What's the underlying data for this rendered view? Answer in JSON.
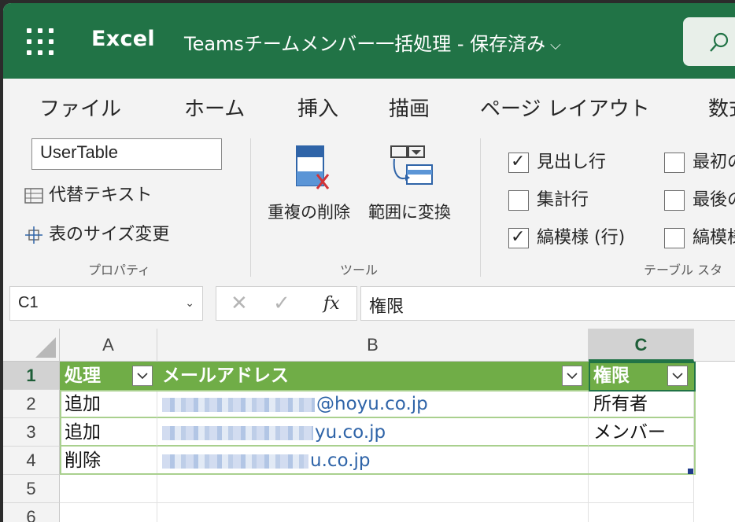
{
  "titlebar": {
    "app_name": "Excel",
    "doc_title": "Teamsチームメンバー一括処理 - 保存済み",
    "doc_title_chevron": "⌵",
    "search_icon": "search-icon",
    "bg_color": "#217346"
  },
  "tabs": [
    "ファイル",
    "ホーム",
    "挿入",
    "描画",
    "ページ レイアウト",
    "数式"
  ],
  "ribbon": {
    "properties": {
      "table_name": "UserTable",
      "alt_text": "代替テキスト",
      "resize": "表のサイズ変更",
      "group_label": "プロパティ"
    },
    "tools": {
      "remove_duplicates": "重複の削除",
      "convert_to_range": "範囲に変換",
      "group_label": "ツール"
    },
    "style_options": {
      "header_row": {
        "label": "見出し行",
        "checked": true
      },
      "total_row": {
        "label": "集計行",
        "checked": false
      },
      "banded_rows": {
        "label": "縞模様 (行)",
        "checked": true
      },
      "first_col": {
        "label": "最初の",
        "checked": false
      },
      "last_col": {
        "label": "最後の",
        "checked": false
      },
      "banded_cols": {
        "label": "縞模様",
        "checked": false
      },
      "group_label": "テーブル スタ"
    }
  },
  "formula_bar": {
    "name_box": "C1",
    "fx": "fx",
    "formula": "権限"
  },
  "grid": {
    "columns": [
      "A",
      "B",
      "C"
    ],
    "rows": [
      "1",
      "2",
      "3",
      "4",
      "5",
      "6"
    ],
    "header": [
      "処理",
      "メールアドレス",
      "権限"
    ],
    "data": [
      {
        "action": "追加",
        "email_visible": "@hoyu.co.jp",
        "permission": "所有者"
      },
      {
        "action": "追加",
        "email_visible": "yu.co.jp",
        "permission": "メンバー"
      },
      {
        "action": "削除",
        "email_visible": "u.co.jp",
        "permission": ""
      }
    ],
    "table_header_color": "#70ad47",
    "selected_cell": "C1"
  }
}
